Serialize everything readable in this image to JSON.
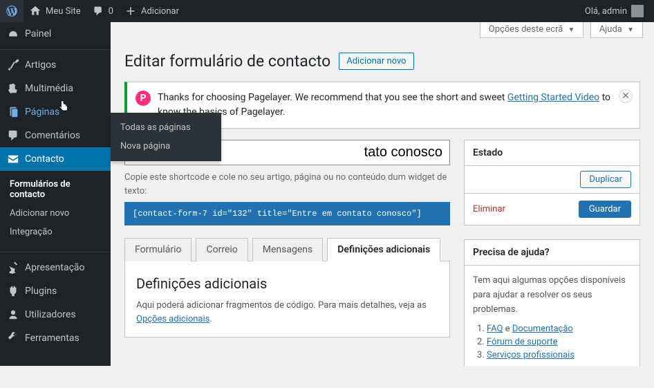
{
  "topbar": {
    "site_name": "Meu Site",
    "comments_count": "0",
    "add_new": "Adicionar",
    "greeting": "Olá, admin"
  },
  "sidebar": {
    "items": [
      {
        "label": "Painel"
      },
      {
        "label": "Artigos"
      },
      {
        "label": "Multimédia"
      },
      {
        "label": "Páginas"
      },
      {
        "label": "Comentários"
      },
      {
        "label": "Contacto"
      },
      {
        "label": "Apresentação"
      },
      {
        "label": "Plugins"
      },
      {
        "label": "Utilizadores"
      },
      {
        "label": "Ferramentas"
      }
    ],
    "contacto_submenu": [
      {
        "label": "Formulários de contacto"
      },
      {
        "label": "Adicionar novo"
      },
      {
        "label": "Integração"
      }
    ],
    "paginas_flyout": [
      {
        "label": "Todas as páginas"
      },
      {
        "label": "Nova página"
      }
    ]
  },
  "screen_meta": {
    "options": "Opções deste ecrã",
    "help": "Ajuda"
  },
  "header": {
    "title": "Editar formulário de contacto",
    "add_new": "Adicionar novo"
  },
  "notice": {
    "text_before": "Thanks for choosing Pagelayer. We recommend that you see the short and sweet ",
    "link": "Getting Started Video",
    "text_after": " to know the basics of Pagelayer."
  },
  "form": {
    "title_visible": "tato conosco",
    "shortcode_hint": "Copie este shortcode e cole no seu artigo, página ou no conteúdo dum widget de texto:",
    "shortcode": "[contact-form-7 id=\"132\" title=\"Entre em contato conosco\"]"
  },
  "tabs": {
    "items": [
      {
        "label": "Formulário"
      },
      {
        "label": "Correio"
      },
      {
        "label": "Mensagens"
      },
      {
        "label": "Definições adicionais"
      }
    ],
    "panel": {
      "heading": "Definições adicionais",
      "text_before": "Aqui poderá adicionar fragmentos de código. Para mais detalhes, veja as ",
      "link": "Opções adicionais",
      "text_after": "."
    }
  },
  "status_box": {
    "title": "Estado",
    "duplicate": "Duplicar",
    "delete": "Eliminar",
    "save": "Guardar"
  },
  "help_box": {
    "title": "Precisa de ajuda?",
    "intro": "Tem aqui algumas opções disponíveis para ajudar a resolver os seus problemas.",
    "and": "e",
    "links": [
      {
        "a": "FAQ",
        "b": "Documentação"
      },
      {
        "a": "Fórum de suporte"
      },
      {
        "a": "Serviços profissionais"
      }
    ]
  }
}
